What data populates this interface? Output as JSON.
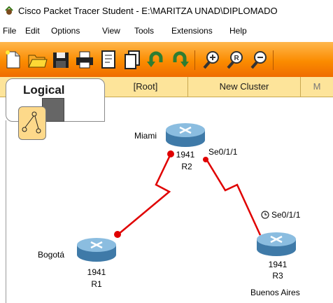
{
  "window": {
    "title": "Cisco Packet Tracer Student - E:\\MARITZA UNAD\\DIPLOMADO"
  },
  "menu": [
    "File",
    "Edit",
    "Options",
    "View",
    "Tools",
    "Extensions",
    "Help"
  ],
  "toolbar": {
    "buttons": [
      "new-icon",
      "open-icon",
      "save-icon",
      "print-icon",
      "activity-wizard-icon",
      "copy-icon",
      "undo-icon",
      "redo-icon",
      "zoom-in-icon",
      "zoom-reset-icon",
      "zoom-out-icon"
    ]
  },
  "workspace": {
    "tab_label": "Logical",
    "breadcrumb": "[Root]",
    "new_cluster": "New Cluster",
    "move_label": "M"
  },
  "topology": {
    "routers": [
      {
        "id": "R2",
        "model": "1941",
        "name": "R2",
        "location": "Miami"
      },
      {
        "id": "R1",
        "model": "1941",
        "name": "R1",
        "location": "Bogotá"
      },
      {
        "id": "R3",
        "model": "1941",
        "name": "R3",
        "location": "Buenos Aires"
      }
    ],
    "interfaces": {
      "r2_r3": "Se0/1/1",
      "r3_r2": "Se0/1/1"
    },
    "colors": {
      "link": "#e00000",
      "link_up": "#e00000",
      "router_body": "#5a8fb6"
    }
  }
}
